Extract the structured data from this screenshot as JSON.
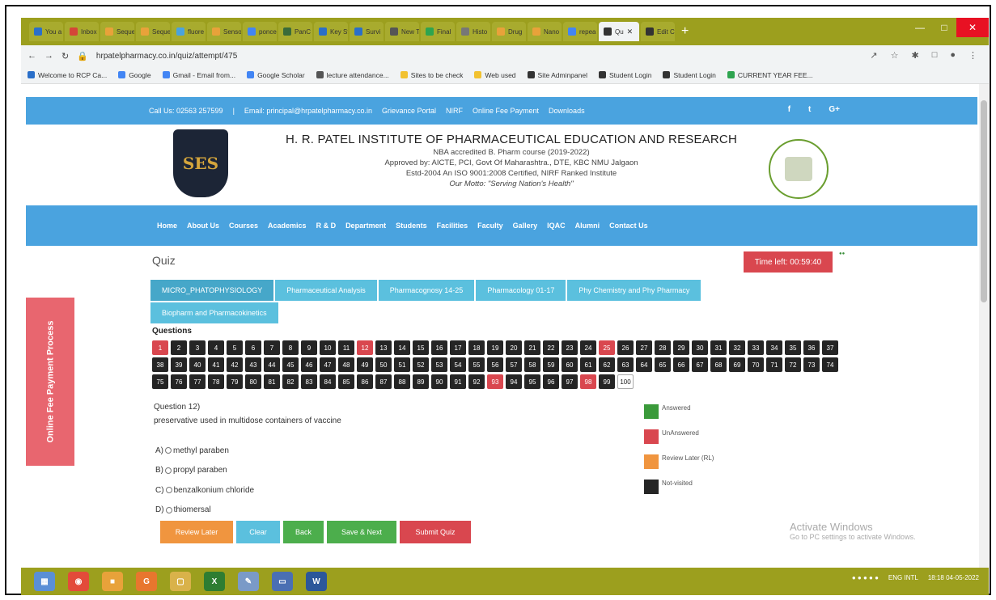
{
  "browser": {
    "tabs": [
      {
        "label": "You a",
        "color": "#2a6fc9"
      },
      {
        "label": "Inbox",
        "color": "#d44638"
      },
      {
        "label": "Seque",
        "color": "#e8a23a"
      },
      {
        "label": "Seque",
        "color": "#e8a23a"
      },
      {
        "label": "fluore",
        "color": "#4aa3df"
      },
      {
        "label": "Sensor",
        "color": "#e8a23a"
      },
      {
        "label": "ponce",
        "color": "#4285f4"
      },
      {
        "label": "PanC",
        "color": "#3a6b3a"
      },
      {
        "label": "Key St",
        "color": "#2a6fc9"
      },
      {
        "label": "Survi",
        "color": "#2a6fc9"
      },
      {
        "label": "New T",
        "color": "#555555"
      },
      {
        "label": "Final",
        "color": "#2ea44f"
      },
      {
        "label": "Histo",
        "color": "#777777"
      },
      {
        "label": "Drug",
        "color": "#e8a23a"
      },
      {
        "label": "Nano",
        "color": "#e8a23a"
      },
      {
        "label": "repea",
        "color": "#4285f4"
      },
      {
        "label": "Qu",
        "color": "#333333"
      },
      {
        "label": "Edit C",
        "color": "#333333"
      }
    ],
    "active_tab_index": 16,
    "new_tab": "+",
    "url": "hrpatelpharmacy.co.in/quiz/attempt/475",
    "bookmarks": [
      {
        "label": "Welcome to RCP Ca...",
        "color": "#2a6fc9"
      },
      {
        "label": "Google",
        "color": "#4285f4"
      },
      {
        "label": "Gmail - Email from...",
        "color": "#4285f4"
      },
      {
        "label": "Google Scholar",
        "color": "#4285f4"
      },
      {
        "label": "lecture attendance...",
        "color": "#555555"
      },
      {
        "label": "Sites to be check",
        "color": "#f2c230"
      },
      {
        "label": "Web used",
        "color": "#f2c230"
      },
      {
        "label": "Site Adminpanel",
        "color": "#333333"
      },
      {
        "label": "Student Login",
        "color": "#333333"
      },
      {
        "label": "Student Login",
        "color": "#333333"
      },
      {
        "label": "CURRENT YEAR FEE...",
        "color": "#2ea44f"
      }
    ]
  },
  "site": {
    "topbar": {
      "call": "Call Us: 02563 257599",
      "email": "Email: principal@hrpatelpharmacy.co.in",
      "grievance": "Grievance Portal",
      "nirf": "NIRF",
      "fee": "Online Fee Payment",
      "downloads": "Downloads",
      "social": [
        "f",
        "t",
        "G+"
      ]
    },
    "logo_text": "SES",
    "institute_name": "H. R. PATEL INSTITUTE OF PHARMACEUTICAL EDUCATION AND RESEARCH",
    "lines": [
      "NBA accredited B. Pharm course (2019-2022)",
      "Approved by: AICTE, PCI, Govt Of Maharashtra., DTE, KBC NMU Jalgaon",
      "Estd-2004 An ISO 9001:2008 Certified, NIRF Ranked Institute"
    ],
    "motto": "Our Motto: \"Serving Nation's Health\"",
    "nav": [
      "Home",
      "About Us",
      "Courses",
      "Academics",
      "R & D",
      "Department",
      "Students",
      "Facilities",
      "Faculty",
      "Gallery",
      "IQAC",
      "Alumni",
      "Contact Us"
    ]
  },
  "quiz": {
    "title": "Quiz",
    "timer": "Time left: 00:59:40",
    "subjects": [
      "MICRO_PHATOPHYSIOLOGY",
      "Pharmaceutical Analysis",
      "Pharmacognosy 14-25",
      "Pharmacology 01-17",
      "Phy Chemistry and Phy Pharmacy",
      "Biopharm and Pharmacokinetics"
    ],
    "questions_heading": "Questions",
    "total_questions": 100,
    "unanswered": [
      1,
      12,
      25,
      93,
      98
    ],
    "not_visited_white": [
      100
    ],
    "current": {
      "number": "Question 12)",
      "text": "preservative used in multidose containers of vaccine",
      "options": [
        {
          "key": "A)",
          "text": "methyl paraben"
        },
        {
          "key": "B)",
          "text": "propyl paraben"
        },
        {
          "key": "C)",
          "text": "benzalkonium chloride"
        },
        {
          "key": "D)",
          "text": "thiomersal"
        }
      ]
    },
    "legend": [
      {
        "label": "Answered",
        "color": "#3a9a3a"
      },
      {
        "label": "UnAnswered",
        "color": "#d9474f"
      },
      {
        "label": "Review Later (RL)",
        "color": "#f0953f"
      },
      {
        "label": "Not-visited",
        "color": "#252525"
      }
    ],
    "buttons": [
      {
        "label": "Review Later",
        "color": "#f0953f"
      },
      {
        "label": "Clear",
        "color": "#5bc0de"
      },
      {
        "label": "Back",
        "color": "#4cae4c"
      },
      {
        "label": "Save & Next",
        "color": "#4cae4c"
      },
      {
        "label": "Submit Quiz",
        "color": "#d9474f"
      }
    ],
    "side_button": "Online Fee Payment Process"
  },
  "windows": {
    "activate_title": "Activate Windows",
    "activate_sub": "Go to PC settings to activate Windows.",
    "tray_lang": "ENG INTL",
    "tray_time": "18:18",
    "tray_date": "04-05-2022"
  }
}
